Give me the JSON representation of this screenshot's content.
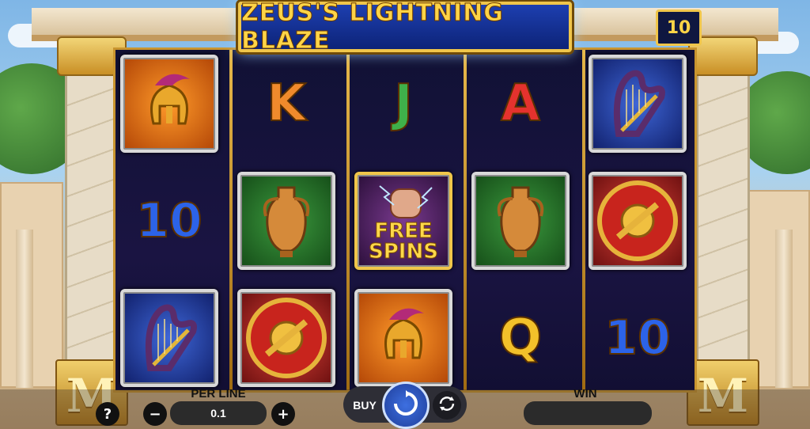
{
  "game": {
    "title": "ZEUS'S LIGHTNING BLAZE",
    "lines_count": "10"
  },
  "reels": [
    [
      {
        "symbol": "helmet",
        "kind": "image",
        "bg": "orange"
      },
      {
        "symbol": "ten",
        "kind": "letter",
        "text": "10"
      },
      {
        "symbol": "harp",
        "kind": "image",
        "bg": "blue"
      }
    ],
    [
      {
        "symbol": "king",
        "kind": "letter",
        "text": "K"
      },
      {
        "symbol": "amphora",
        "kind": "image",
        "bg": "green"
      },
      {
        "symbol": "shield",
        "kind": "image",
        "bg": "red"
      }
    ],
    [
      {
        "symbol": "jack",
        "kind": "letter",
        "text": "J"
      },
      {
        "symbol": "free-spins",
        "kind": "scatter",
        "text_line1": "FREE",
        "text_line2": "SPINS"
      },
      {
        "symbol": "helmet",
        "kind": "image",
        "bg": "orange"
      }
    ],
    [
      {
        "symbol": "ace",
        "kind": "letter",
        "text": "A"
      },
      {
        "symbol": "amphora",
        "kind": "image",
        "bg": "green"
      },
      {
        "symbol": "queen",
        "kind": "letter",
        "text": "Q"
      }
    ],
    [
      {
        "symbol": "harp",
        "kind": "image",
        "bg": "blue"
      },
      {
        "symbol": "shield",
        "kind": "image",
        "bg": "red"
      },
      {
        "symbol": "ten",
        "kind": "letter",
        "text": "10"
      }
    ]
  ],
  "controls": {
    "help": "?",
    "per_line_label": "PER LINE",
    "per_line_value": "0.1",
    "minus": "−",
    "plus": "+",
    "buy_label": "BUY",
    "win_label": "WIN",
    "win_value": ""
  },
  "colors": {
    "gold": "#f0c64a",
    "title_blue": "#1d3fb0",
    "reel_bg": "#111135"
  }
}
